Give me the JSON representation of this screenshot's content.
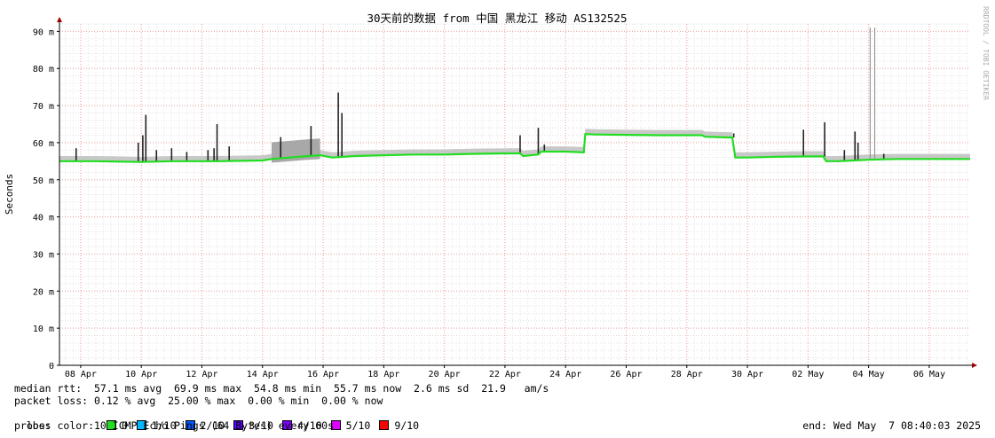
{
  "chart_data": {
    "type": "line",
    "title": "30天前的数据 from 中国 黑龙江 移动 AS132525",
    "ylabel": "Seconds",
    "watermark": "RRDTOOL / TOBI OETIKER",
    "ylim": [
      0,
      92
    ],
    "y_ticks": [
      {
        "value": 0,
        "label": "0"
      },
      {
        "value": 10,
        "label": "10 m"
      },
      {
        "value": 20,
        "label": "20 m"
      },
      {
        "value": 30,
        "label": "30 m"
      },
      {
        "value": 40,
        "label": "40 m"
      },
      {
        "value": 50,
        "label": "50 m"
      },
      {
        "value": 60,
        "label": "60 m"
      },
      {
        "value": 70,
        "label": "70 m"
      },
      {
        "value": 80,
        "label": "80 m"
      },
      {
        "value": 90,
        "label": "90 m"
      }
    ],
    "x_range_days": [
      7.3,
      37.35
    ],
    "x_ticks": [
      {
        "day": 8,
        "label": "08 Apr"
      },
      {
        "day": 10,
        "label": "10 Apr"
      },
      {
        "day": 12,
        "label": "12 Apr"
      },
      {
        "day": 14,
        "label": "14 Apr"
      },
      {
        "day": 16,
        "label": "16 Apr"
      },
      {
        "day": 18,
        "label": "18 Apr"
      },
      {
        "day": 20,
        "label": "20 Apr"
      },
      {
        "day": 22,
        "label": "22 Apr"
      },
      {
        "day": 24,
        "label": "24 Apr"
      },
      {
        "day": 26,
        "label": "26 Apr"
      },
      {
        "day": 28,
        "label": "28 Apr"
      },
      {
        "day": 30,
        "label": "30 Apr"
      },
      {
        "day": 32,
        "label": "02 May"
      },
      {
        "day": 34,
        "label": "04 May"
      },
      {
        "day": 36,
        "label": "06 May"
      }
    ],
    "grid": true,
    "series": [
      {
        "name": "median rtt",
        "color": "#22dd22",
        "points": [
          [
            7.3,
            55.0
          ],
          [
            8.5,
            55.0
          ],
          [
            10.0,
            54.8
          ],
          [
            11.0,
            55.0
          ],
          [
            12.0,
            55.0
          ],
          [
            12.5,
            55.0
          ],
          [
            14.0,
            55.2
          ],
          [
            14.3,
            55.6
          ],
          [
            14.9,
            56.0
          ],
          [
            15.5,
            56.4
          ],
          [
            15.9,
            56.6
          ],
          [
            16.3,
            56.0
          ],
          [
            16.7,
            56.2
          ],
          [
            17.0,
            56.4
          ],
          [
            18.0,
            56.6
          ],
          [
            19.0,
            56.8
          ],
          [
            20.0,
            56.8
          ],
          [
            21.0,
            57.0
          ],
          [
            22.0,
            57.1
          ],
          [
            22.5,
            57.1
          ],
          [
            22.6,
            56.4
          ],
          [
            23.1,
            56.8
          ],
          [
            23.2,
            57.6
          ],
          [
            24.0,
            57.6
          ],
          [
            24.6,
            57.4
          ],
          [
            24.65,
            62.3
          ],
          [
            25.0,
            62.2
          ],
          [
            26.0,
            62.1
          ],
          [
            27.0,
            62.0
          ],
          [
            28.0,
            62.0
          ],
          [
            28.5,
            62.0
          ],
          [
            28.6,
            61.6
          ],
          [
            29.0,
            61.5
          ],
          [
            29.5,
            61.4
          ],
          [
            29.6,
            56.0
          ],
          [
            30.0,
            56.0
          ],
          [
            31.0,
            56.2
          ],
          [
            32.0,
            56.3
          ],
          [
            32.5,
            56.3
          ],
          [
            32.6,
            55.0
          ],
          [
            33.0,
            55.0
          ],
          [
            33.5,
            55.2
          ],
          [
            34.0,
            55.4
          ],
          [
            34.5,
            55.5
          ],
          [
            35.0,
            55.6
          ],
          [
            36.0,
            55.6
          ],
          [
            37.0,
            55.6
          ],
          [
            37.35,
            55.6
          ]
        ]
      }
    ],
    "spikes": [
      {
        "day": 7.85,
        "value": 58.5
      },
      {
        "day": 9.9,
        "value": 60.0
      },
      {
        "day": 10.05,
        "value": 62.0
      },
      {
        "day": 10.15,
        "value": 67.5
      },
      {
        "day": 10.5,
        "value": 58.0
      },
      {
        "day": 11.0,
        "value": 58.5
      },
      {
        "day": 11.5,
        "value": 57.5
      },
      {
        "day": 12.2,
        "value": 58.0
      },
      {
        "day": 12.4,
        "value": 58.5
      },
      {
        "day": 12.9,
        "value": 59.0
      },
      {
        "day": 12.5,
        "value": 65.0
      },
      {
        "day": 14.6,
        "value": 61.5
      },
      {
        "day": 15.6,
        "value": 64.5
      },
      {
        "day": 16.5,
        "value": 73.5
      },
      {
        "day": 16.62,
        "value": 68.0
      },
      {
        "day": 22.5,
        "value": 62.0
      },
      {
        "day": 23.1,
        "value": 64.0
      },
      {
        "day": 23.3,
        "value": 59.5
      },
      {
        "day": 29.55,
        "value": 62.5
      },
      {
        "day": 31.85,
        "value": 63.5
      },
      {
        "day": 32.55,
        "value": 65.5
      },
      {
        "day": 33.2,
        "value": 58.0
      },
      {
        "day": 33.55,
        "value": 63.0
      },
      {
        "day": 33.65,
        "value": 60.0
      },
      {
        "day": 34.05,
        "value": 91.0
      },
      {
        "day": 34.2,
        "value": 91.0
      },
      {
        "day": 34.5,
        "value": 57.0
      }
    ]
  },
  "footer": {
    "median_rtt": "median rtt:  57.1 ms avg  69.9 ms max  54.8 ms min  55.7 ms now  2.6 ms sd  21.9   am/s",
    "packet_loss": "packet loss: 0.12 % avg  25.00 % max  0.00 % min  0.00 % now",
    "loss_color_label": "loss color:",
    "loss_colors": [
      {
        "label": "0",
        "color": "#22dd22"
      },
      {
        "label": "1/10",
        "color": "#00b8ff"
      },
      {
        "label": "2/10",
        "color": "#0059ff"
      },
      {
        "label": "3/10",
        "color": "#5e00ff"
      },
      {
        "label": "4/10",
        "color": "#7e00ff"
      },
      {
        "label": "5/10",
        "color": "#dd00ff"
      },
      {
        "label": "9/10",
        "color": "#ff0000"
      }
    ],
    "probe": "probe:       10 ICMP Echo Pings (64 Bytes) every 60s",
    "end": "end: Wed May  7 08:40:03 2025"
  }
}
